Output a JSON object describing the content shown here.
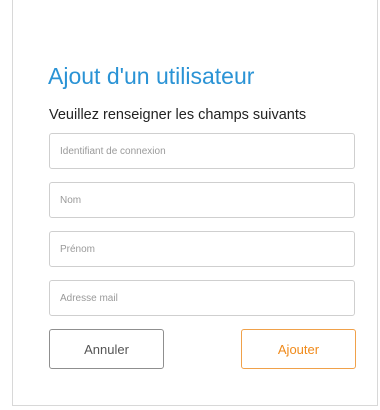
{
  "form": {
    "title": "Ajout d'un utilisateur",
    "subtitle": "Veuillez renseigner les champs suivants",
    "fields": {
      "login_placeholder": "Identifiant de connexion",
      "nom_placeholder": "Nom",
      "prenom_placeholder": "Prénom",
      "mail_placeholder": "Adresse mail"
    },
    "buttons": {
      "cancel_label": "Annuler",
      "add_label": "Ajouter"
    }
  },
  "colors": {
    "title": "#2a93d5",
    "add_accent": "#f08a1a",
    "cancel_border": "#8f8f8f"
  }
}
